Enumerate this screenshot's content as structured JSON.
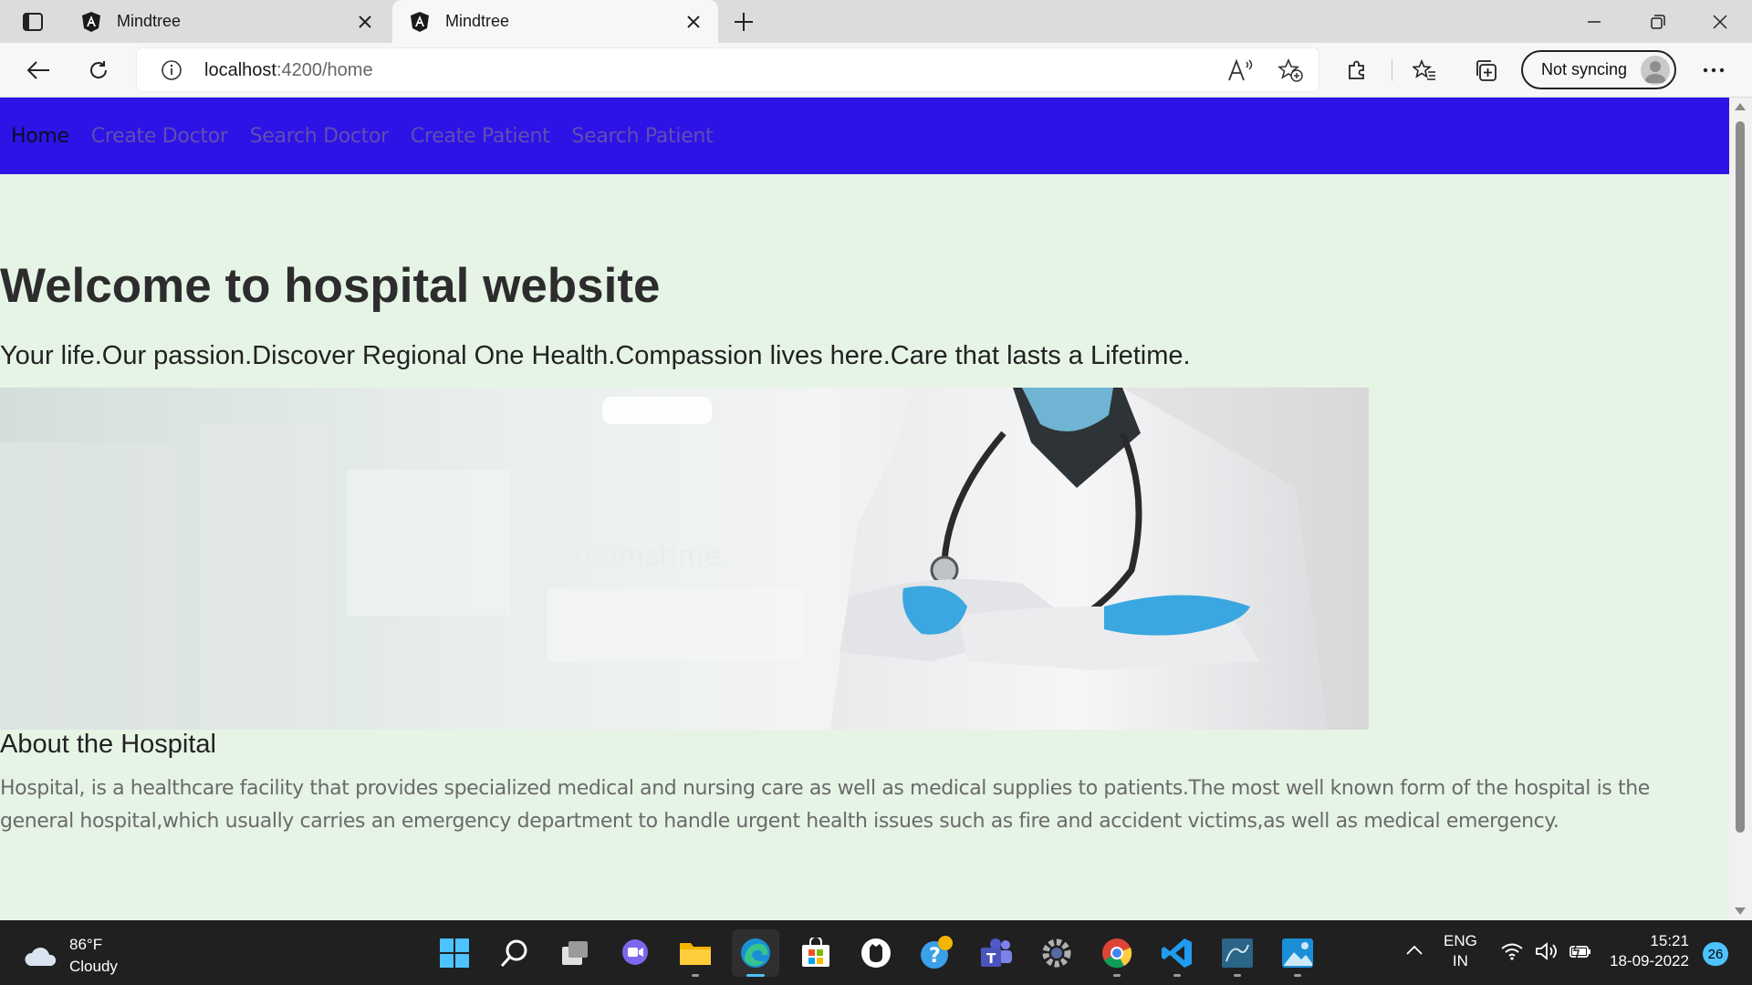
{
  "browser": {
    "tabs": [
      {
        "title": "Mindtree",
        "icon": "angular-icon",
        "active": false
      },
      {
        "title": "Mindtree",
        "icon": "angular-icon",
        "active": true
      }
    ],
    "address": {
      "host": "localhost",
      "path": ":4200/home"
    },
    "sync_label": "Not syncing"
  },
  "nav": {
    "items": [
      "Home",
      "Create Doctor",
      "Search Doctor",
      "Create Patient",
      "Search Patient"
    ],
    "active": "Home"
  },
  "main": {
    "title": "Welcome to hospital website",
    "tagline": "Your life.Our passion.Discover Regional One Health.Compassion lives here.Care that lasts a Lifetime.",
    "hero_image": "doctor-with-stethoscope-image",
    "about_title": "About the Hospital",
    "about_text": "Hospital, is a healthcare facility that provides specialized medical and nursing care as well as medical supplies to patients.The most well known form of the hospital is the general hospital,which usually carries an emergency department to handle urgent health issues such as fire and accident victims,as well as medical emergency."
  },
  "taskbar": {
    "weather": {
      "temp": "86°F",
      "condition": "Cloudy"
    },
    "apps": [
      "windows-start-icon",
      "search-icon",
      "task-view-icon",
      "chat-icon",
      "file-explorer-icon",
      "edge-icon",
      "store-icon",
      "github-icon",
      "help-icon",
      "teams-icon",
      "settings-icon",
      "chrome-icon",
      "vscode-icon",
      "mysql-workbench-icon",
      "photos-icon"
    ],
    "lang": {
      "line1": "ENG",
      "line2": "IN"
    },
    "clock": {
      "time": "15:21",
      "date": "18-09-2022"
    },
    "notifications": "26"
  },
  "colors": {
    "navbar": "#2d13e6",
    "page_bg": "#e6f4e6",
    "active_nav": "#0d0d22",
    "nav_link": "#5f4fb0"
  }
}
